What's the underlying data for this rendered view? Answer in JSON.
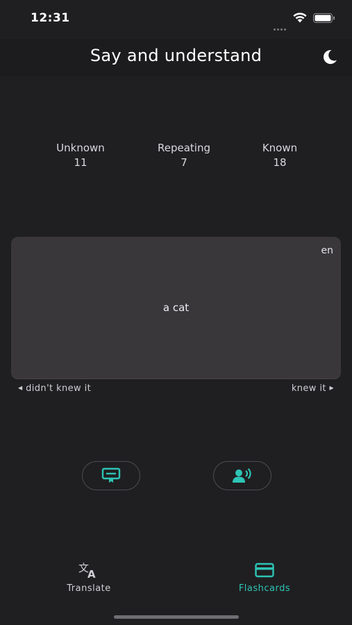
{
  "status_bar": {
    "time": "12:31"
  },
  "header": {
    "title": "Say and understand",
    "theme_icon": "moon-icon"
  },
  "stats": [
    {
      "label": "Unknown",
      "value": "11"
    },
    {
      "label": "Repeating",
      "value": "7"
    },
    {
      "label": "Known",
      "value": "18"
    }
  ],
  "card": {
    "language": "en",
    "word": "a cat"
  },
  "swipe": {
    "left_label": "didn't knew it",
    "right_label": "knew it"
  },
  "actions": {
    "left_icon": "certificate-icon",
    "right_icon": "speak-icon"
  },
  "tabs": [
    {
      "label": "Translate",
      "icon": "translate-icon",
      "active": false
    },
    {
      "label": "Flashcards",
      "icon": "card-icon",
      "active": true
    }
  ],
  "colors": {
    "accent": "#2ec4b6",
    "background": "#1f1f21",
    "card": "#3a373b"
  }
}
